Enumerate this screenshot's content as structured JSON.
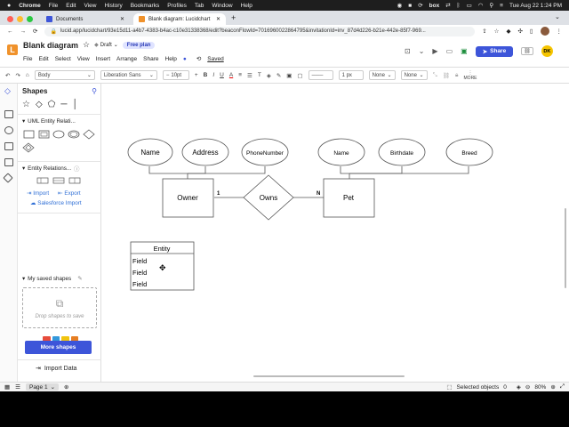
{
  "macos": {
    "app": "Chrome",
    "menus": [
      "File",
      "Edit",
      "View",
      "History",
      "Bookmarks",
      "Profiles",
      "Tab",
      "Window",
      "Help"
    ],
    "clock": "Tue Aug 22  1:24 PM",
    "box_label": "box"
  },
  "browser": {
    "tabs": [
      {
        "title": "Documents",
        "active": false
      },
      {
        "title": "Blank diagram: Lucidchart",
        "active": true
      }
    ],
    "url": "lucid.app/lucidchart/93e15d11-a4b7-4383-b4ac-c10e31338368/edit?beaconFlowId=7016960022864795&invitationId=inv_87d4d226-b21e-442e-85f7-969..."
  },
  "app": {
    "doc_title": "Blank diagram",
    "draft": "Draft",
    "plan": "Free plan",
    "menus": [
      "File",
      "Edit",
      "Select",
      "View",
      "Insert",
      "Arrange",
      "Share",
      "Help"
    ],
    "saved": "Saved",
    "share_label": "Share",
    "avatar_initials": "DK",
    "more_label": "MORE"
  },
  "toolbar": {
    "style": "Body",
    "font": "Liberation Sans",
    "font_size": "10pt",
    "line_width": "1 px",
    "arrow_start": "None",
    "arrow_end": "None"
  },
  "sidebar": {
    "title": "Shapes",
    "sections": {
      "uml": "UML Entity Relati...",
      "er": "Entity Relations...",
      "saved": "My saved shapes"
    },
    "import": "Import",
    "export": "Export",
    "salesforce": "Salesforce Import",
    "drop_hint": "Drop shapes to save",
    "more_shapes": "More shapes",
    "import_data": "Import Data"
  },
  "diagram": {
    "owner_attrs": [
      "Name",
      "Address",
      "PhoneNumber"
    ],
    "pet_attrs": [
      "Name",
      "Birthdate",
      "Breed"
    ],
    "owner": "Owner",
    "relation": "Owns",
    "pet": "Pet",
    "card_left": "1",
    "card_right": "N",
    "entity_title": "Entity",
    "entity_fields": [
      "Field",
      "Field",
      "Field"
    ]
  },
  "status": {
    "page": "Page 1",
    "selected": "Selected objects",
    "selected_count": "0",
    "zoom": "80%"
  },
  "colors": {
    "accent": "#3d55d9",
    "plan_badge": "#dfe3ff",
    "logo": "#f0922b",
    "avatar": "#f5c400",
    "link": "#2f6fd6"
  }
}
